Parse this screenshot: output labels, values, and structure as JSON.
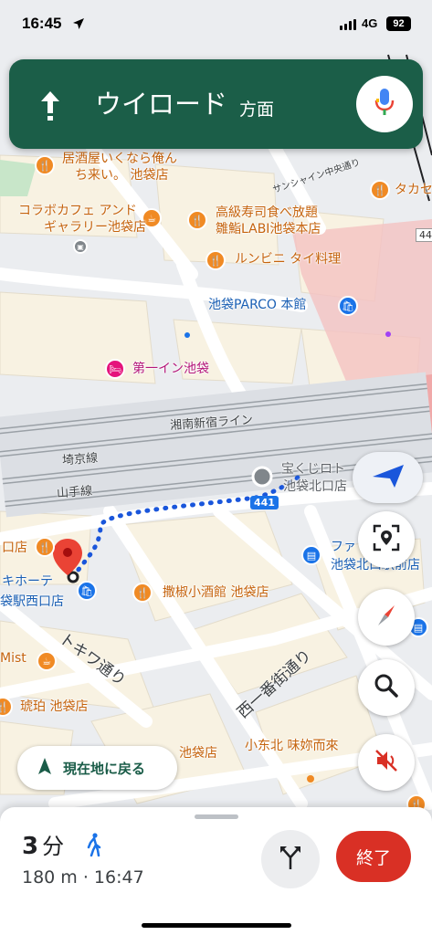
{
  "status_bar": {
    "time": "16:45",
    "network": "4G",
    "battery": "92"
  },
  "banner": {
    "destination": "ウイロード",
    "direction_suffix": "方面",
    "maneuver_icon": "arrow-up-icon",
    "mic_icon": "microphone-icon"
  },
  "map": {
    "pois": [
      {
        "label": "居酒屋いくなら俺ん",
        "style": "orange"
      },
      {
        "label": "ち来い。 池袋店",
        "style": "orange"
      },
      {
        "label": "コラボカフェ アンド",
        "style": "orange"
      },
      {
        "label": "ギャラリー池袋店",
        "style": "orange"
      },
      {
        "label": "高級寿司食べ放題",
        "style": "orange"
      },
      {
        "label": "雛鮨LABI池袋本店",
        "style": "orange"
      },
      {
        "label": "ルンビニ タイ料理",
        "style": "orange"
      },
      {
        "label": "池袋PARCO 本館",
        "style": "blue"
      },
      {
        "label": "第一イン池袋",
        "style": "pink"
      },
      {
        "label": "宝くじロト",
        "style": "gray"
      },
      {
        "label": "池袋北口店",
        "style": "gray"
      },
      {
        "label": "ファ",
        "style": "blue"
      },
      {
        "label": "池袋北口駅前店",
        "style": "blue"
      },
      {
        "label": "撒椒小酒館 池袋店",
        "style": "orange"
      },
      {
        "label": "口店",
        "style": "orange"
      },
      {
        "label": "キホーテ",
        "style": "blue"
      },
      {
        "label": "袋駅西口店",
        "style": "blue"
      },
      {
        "label": "Mist",
        "style": "orange"
      },
      {
        "label": "琥珀 池袋店",
        "style": "orange"
      },
      {
        "label": "池袋店",
        "style": "orange"
      },
      {
        "label": "小东北 味妳而來",
        "style": "orange"
      },
      {
        "label": "タカセ",
        "style": "orange"
      }
    ],
    "streets": {
      "shonan": "湘南新宿ライン",
      "saikyo": "埼京線",
      "yamanote": "山手線",
      "sunshine": "サンシャイン中央通り",
      "tokiwa": "トキワ通り",
      "nishiichiban": "西一番街通り",
      "route_shield": "441",
      "edge_num": "44"
    }
  },
  "controls": {
    "compass_icon": "navigation-arrow-icon",
    "lens_icon": "lens-search-icon",
    "north_icon": "compass-north-icon",
    "search_icon": "search-icon",
    "mute_icon": "sound-off-icon"
  },
  "recenter": {
    "label": "現在地に戻る"
  },
  "sheet": {
    "duration": "3",
    "duration_unit": "分",
    "distance_eta": "180 m · 16:47",
    "end_label": "終了",
    "alt_routes_icon": "alternate-routes-icon",
    "walk_icon": "walking-icon"
  },
  "colors": {
    "banner": "#1b5e48",
    "route": "#1a56db",
    "end_button": "#d93025",
    "accent": "#1a73e8"
  }
}
